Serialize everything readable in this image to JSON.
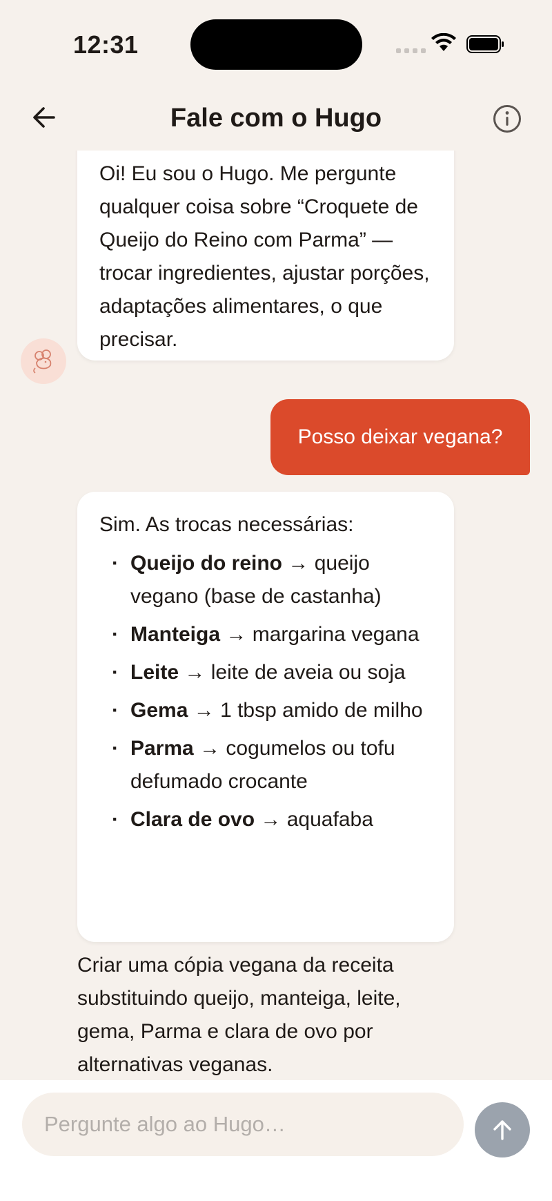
{
  "status_bar": {
    "time": "12:31"
  },
  "header": {
    "title": "Fale com o Hugo"
  },
  "messages": {
    "bot_greeting": "Oi! Eu sou o Hugo. Me pergunte qualquer coisa sobre “Croquete de Queijo do Reino com Parma” — trocar ingredientes, ajustar porções, adaptações alimentares, o que precisar.",
    "user_question": "Posso deixar vegana?",
    "bot_answer_intro": "Sim. As trocas necessárias:",
    "swaps": [
      {
        "from": "Queijo do reino",
        "to": "queijo vegano (base de castanha)"
      },
      {
        "from": "Manteiga",
        "to": "margarina vegana"
      },
      {
        "from": "Leite",
        "to": "leite de aveia ou soja"
      },
      {
        "from": "Gema",
        "to": "1 tbsp amido de milho"
      },
      {
        "from": "Parma",
        "to": "cogumelos ou tofu defumado crocante"
      },
      {
        "from": "Clara de ovo",
        "to": "aquafaba"
      }
    ],
    "arrow": "→",
    "bot_followup": "Criar uma cópia vegana da receita substituindo queijo, manteiga, leite, gema, Parma e clara de ovo por alternativas veganas."
  },
  "composer": {
    "placeholder": "Pergunte algo ao Hugo…"
  },
  "colors": {
    "accent": "#db4a2b",
    "background": "#f6f1ec",
    "send_button": "#9ba3ad"
  }
}
